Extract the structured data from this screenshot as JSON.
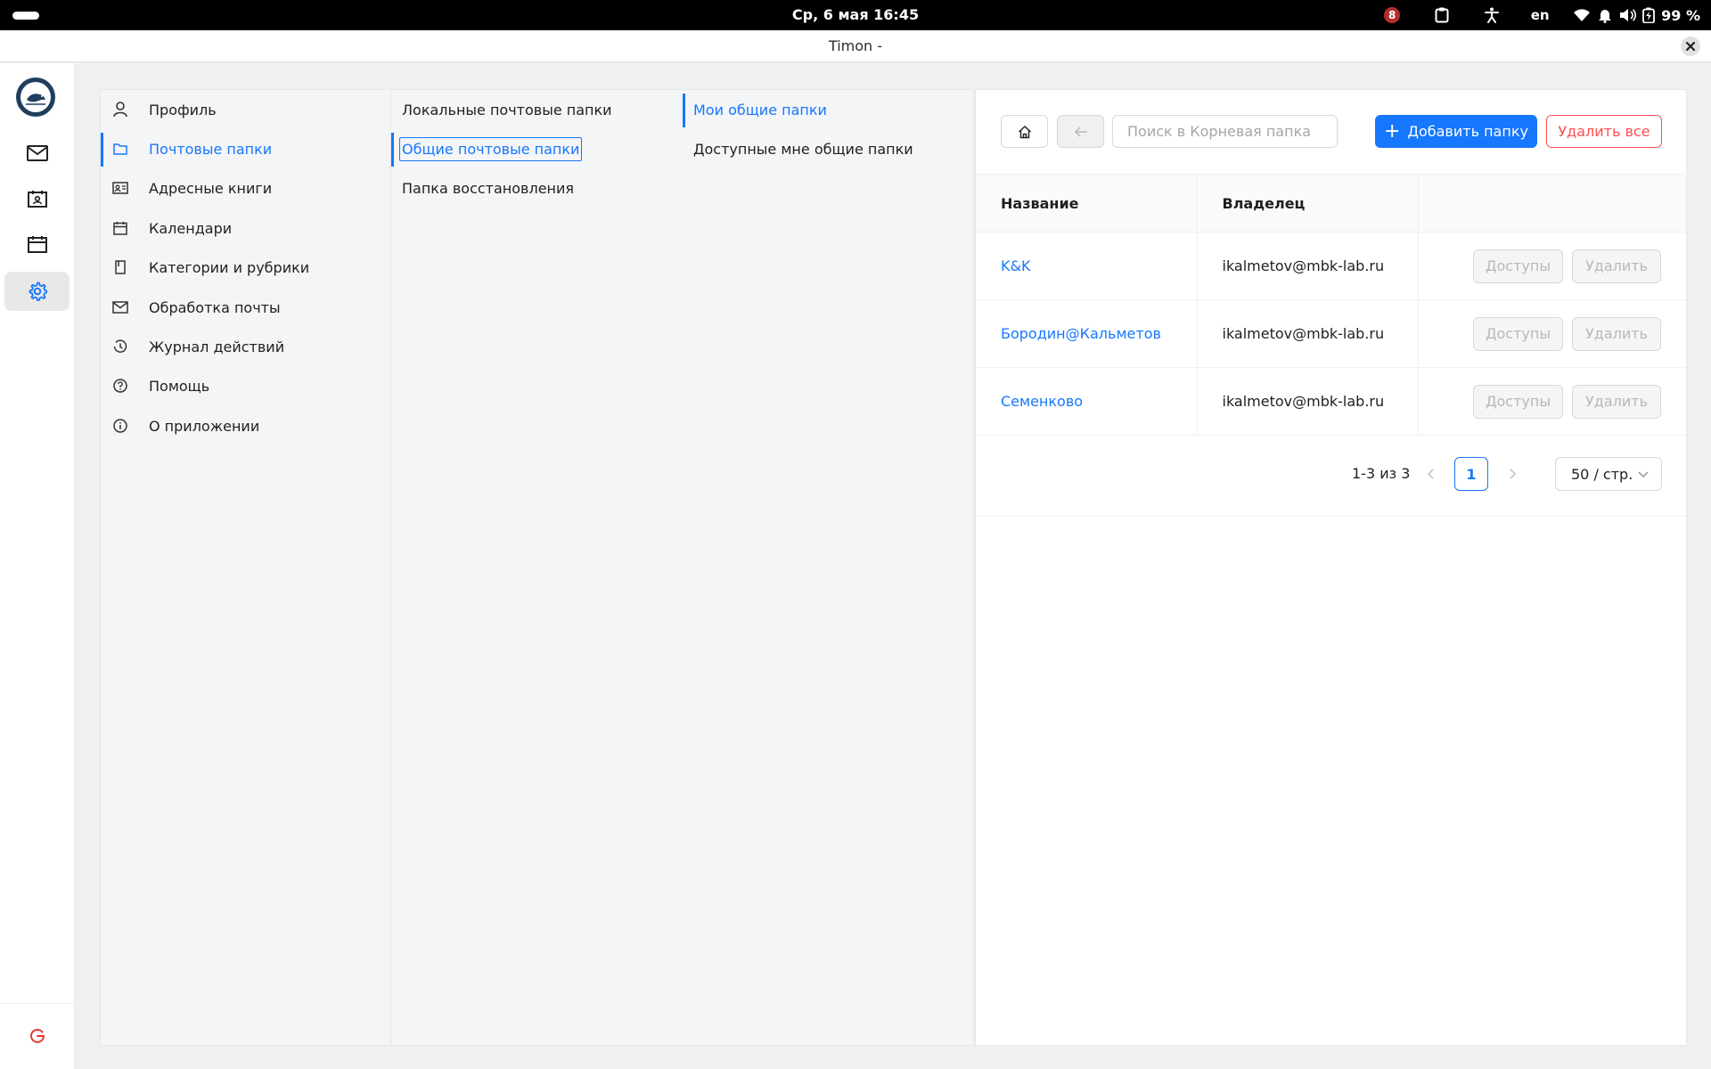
{
  "system_bar": {
    "clock": "Ср, 6 мая  16:45",
    "notification_count": "8",
    "language": "en",
    "battery": "99 %"
  },
  "window": {
    "title": "Timon -"
  },
  "settings_menu": {
    "items": [
      {
        "label": "Профиль",
        "icon": "user-icon"
      },
      {
        "label": "Почтовые папки",
        "icon": "folder-icon",
        "active": true
      },
      {
        "label": "Адресные книги",
        "icon": "contact-card-icon"
      },
      {
        "label": "Календари",
        "icon": "calendar-icon"
      },
      {
        "label": "Категории и рубрики",
        "icon": "bookmark-icon"
      },
      {
        "label": "Обработка почты",
        "icon": "mail-icon"
      },
      {
        "label": "Журнал действий",
        "icon": "history-icon"
      },
      {
        "label": "Помощь",
        "icon": "help-icon"
      },
      {
        "label": "О приложении",
        "icon": "info-icon"
      }
    ]
  },
  "folders_submenu": {
    "items": [
      {
        "label": "Локальные почтовые папки"
      },
      {
        "label": "Общие почтовые папки",
        "active": true
      },
      {
        "label": "Папка восстановления"
      }
    ]
  },
  "shared_submenu": {
    "items": [
      {
        "label": "Мои общие папки",
        "active": true
      },
      {
        "label": "Доступные мне общие папки"
      }
    ]
  },
  "toolbar": {
    "search_placeholder": "Поиск в Корневая папка",
    "add_label": "Добавить папку",
    "delete_all_label": "Удалить все"
  },
  "table": {
    "columns": [
      "Название",
      "Владелец",
      ""
    ],
    "rows": [
      {
        "name": "K&K",
        "owner": "ikalmetov@mbk-lab.ru",
        "access_label": "Доступы",
        "delete_label": "Удалить"
      },
      {
        "name": "Бородин@Кальметов",
        "owner": "ikalmetov@mbk-lab.ru",
        "access_label": "Доступы",
        "delete_label": "Удалить"
      },
      {
        "name": "Семенково",
        "owner": "ikalmetov@mbk-lab.ru",
        "access_label": "Доступы",
        "delete_label": "Удалить"
      }
    ]
  },
  "pagination": {
    "range": "1-3 из 3",
    "current_page": "1",
    "page_size": "50 / стр."
  },
  "colors": {
    "accent": "#1677ff",
    "danger": "#ff4d4f",
    "logout": "#e53935"
  }
}
